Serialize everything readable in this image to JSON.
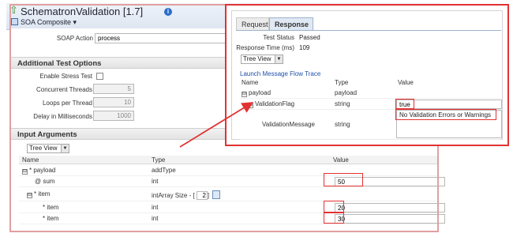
{
  "window": {
    "title": "SchematronValidation [1.7]",
    "info_glyph": "i",
    "up_glyph": "⇧",
    "subtitle": "SOA Composite"
  },
  "soap": {
    "label": "SOAP Action",
    "value": "process"
  },
  "additional_options": {
    "heading": "Additional Test Options",
    "enable_stress_label": "Enable Stress Test",
    "enable_stress_checked": false,
    "concurrent_threads_label": "Concurrent Threads",
    "concurrent_threads_value": "5",
    "loops_label": "Loops per Thread",
    "loops_value": "10",
    "delay_label": "Delay in Milliseconds",
    "delay_value": "1000"
  },
  "input_arguments": {
    "heading": "Input Arguments",
    "view_select": "Tree View",
    "columns": {
      "name": "Name",
      "type": "Type",
      "value": "Value"
    },
    "rows": [
      {
        "toggle": "⊟",
        "name": "* payload",
        "type": "addType",
        "value": ""
      },
      {
        "toggle": "",
        "name": "@ sum",
        "type": "int",
        "value": "50"
      },
      {
        "toggle": "⊟",
        "name": "* item",
        "type": "intArray Size - [",
        "size": "2",
        "size_suffix": "]",
        "value": ""
      },
      {
        "toggle": "",
        "name": "* item",
        "type": "int",
        "value": "20"
      },
      {
        "toggle": "",
        "name": "* item",
        "type": "int",
        "value": "30"
      }
    ]
  },
  "response_panel": {
    "tabs": [
      {
        "label": "Request",
        "active": false
      },
      {
        "label": "Response",
        "active": true
      }
    ],
    "test_status_label": "Test Status",
    "test_status_value": "Passed",
    "response_time_label": "Response Time (ms)",
    "response_time_value": "109",
    "view_select": "Tree View",
    "trace_link": "Launch Message Flow Trace",
    "columns": {
      "name": "Name",
      "type": "Type",
      "value": "Value"
    },
    "rows": [
      {
        "toggle": "⊟",
        "name": "payload",
        "type": "payload",
        "value": ""
      },
      {
        "toggle": "⊟",
        "name": "ValidationFlag",
        "type": "string",
        "value": "true"
      },
      {
        "toggle": "",
        "name": "ValidationMessage",
        "type": "string",
        "value": "No Validation Errors or Warnings"
      }
    ]
  },
  "colors": {
    "highlight": "#e23232",
    "arrow": "#e23232",
    "link": "#1f4fa8",
    "title_bar": "#dde6f1"
  }
}
